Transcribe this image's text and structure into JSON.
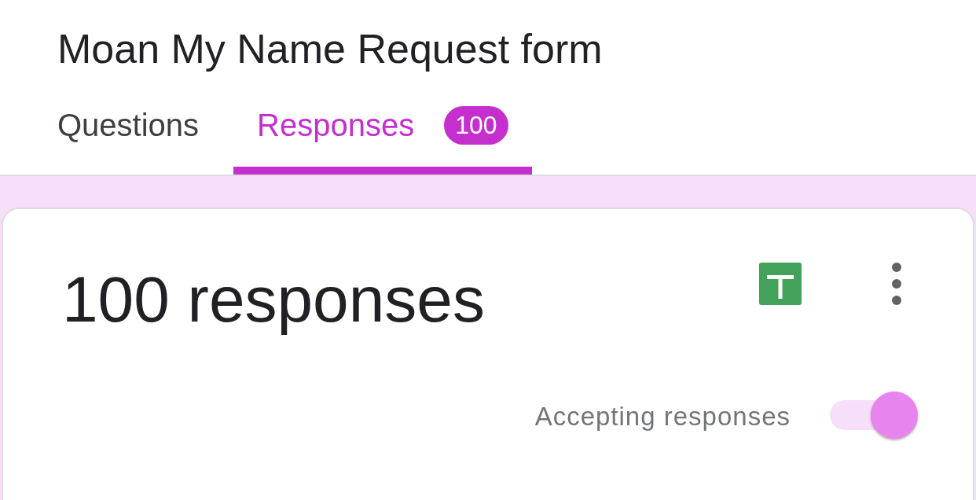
{
  "form_title": "Moan My Name Request form",
  "tabs": [
    {
      "label": "Questions",
      "selected": false
    },
    {
      "label": "Responses",
      "selected": true,
      "badge": "100"
    }
  ],
  "summary": {
    "heading": "100 responses",
    "accepting": {
      "label": "Accepting responses",
      "on": true
    }
  }
}
